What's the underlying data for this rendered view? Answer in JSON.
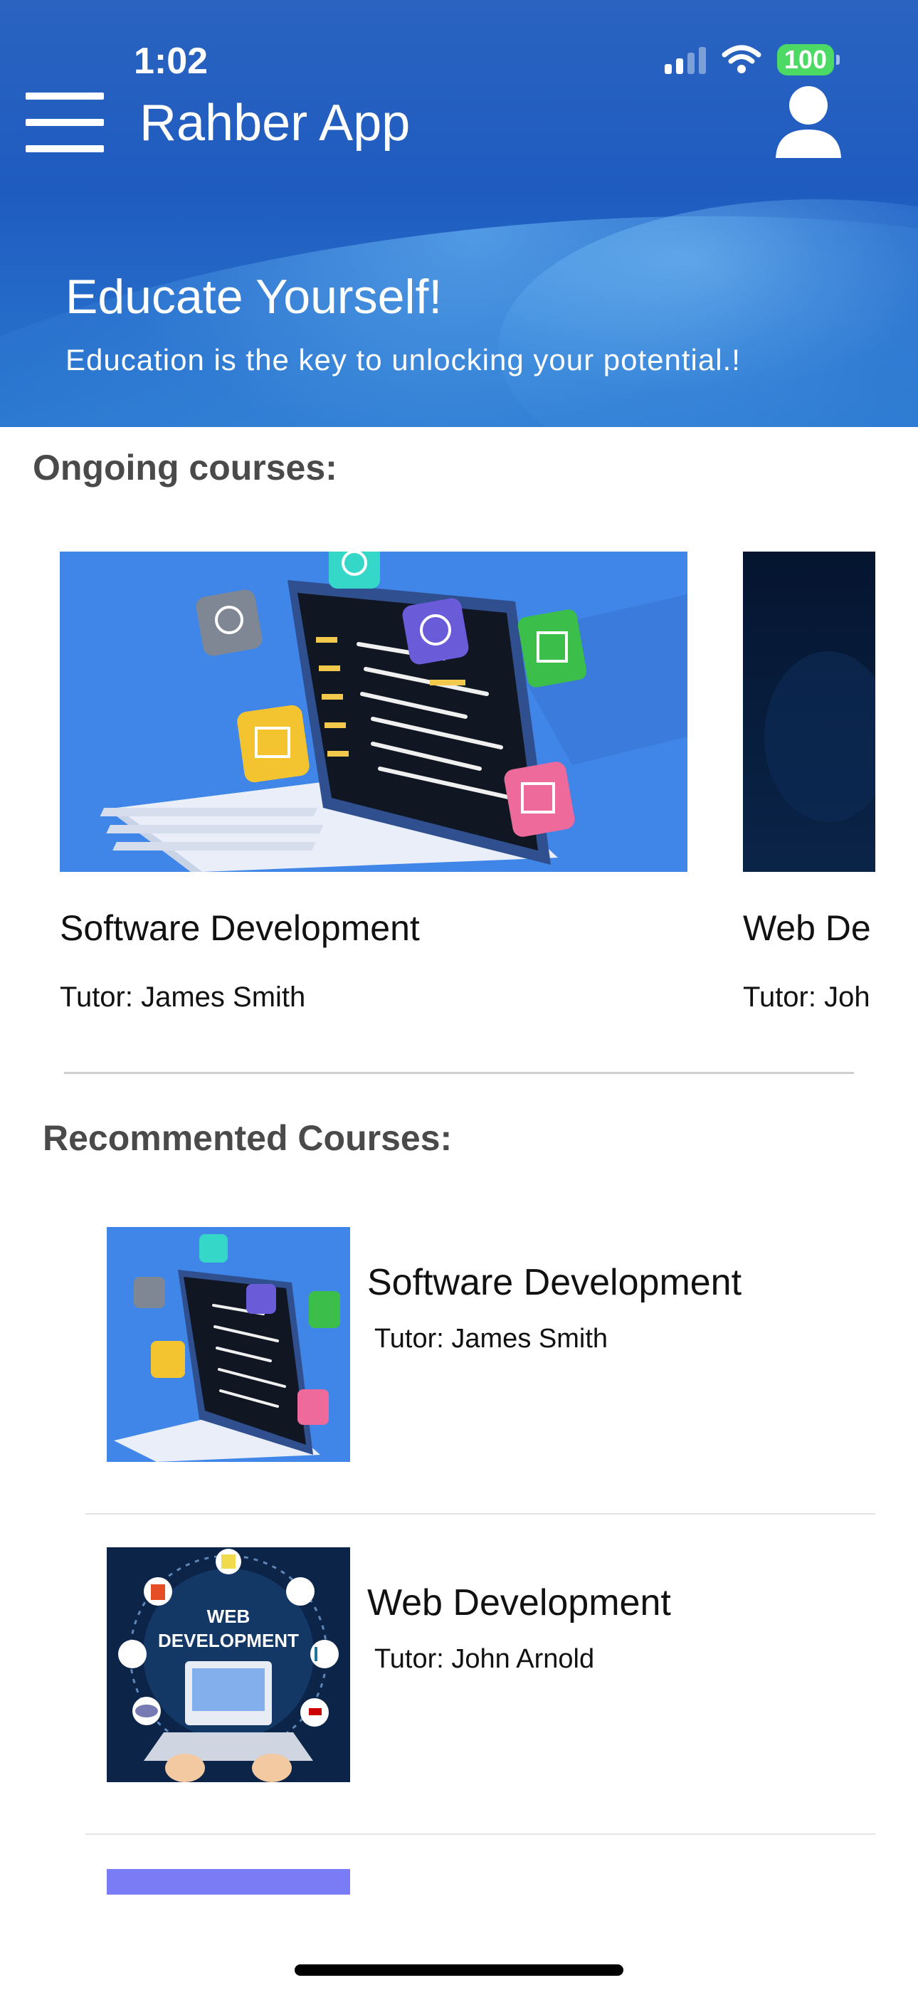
{
  "status_bar": {
    "time": "1:02",
    "battery": "100",
    "icons": [
      "signal-icon",
      "wifi-icon",
      "battery-icon"
    ]
  },
  "header": {
    "menu_icon": "hamburger-menu-icon",
    "title": "Rahber App",
    "profile_icon": "user-profile-icon",
    "hero_title": "Educate Yourself!",
    "hero_subtitle": "Education is the key to unlocking your potential.!"
  },
  "ongoing": {
    "heading": "Ongoing courses:",
    "courses": [
      {
        "name": "Software Development",
        "tutor": "Tutor: James Smith"
      },
      {
        "name": "Web De",
        "tutor": "Tutor: Joh"
      }
    ]
  },
  "recommended": {
    "heading": "Recommented Courses:",
    "courses": [
      {
        "name": "Software Development",
        "tutor": "Tutor: James Smith"
      },
      {
        "name": "Web Development",
        "tutor": "Tutor: John Arnold",
        "thumb_text": [
          "WEB",
          "DEVELOPMENT"
        ]
      }
    ]
  },
  "colors": {
    "header_blue": "#1f5cc0",
    "accent_light_blue": "#3f86e8",
    "battery_green": "#4cd964",
    "partial_thumb": "#7a7cf5",
    "heading_gray": "#4a4a4a"
  }
}
